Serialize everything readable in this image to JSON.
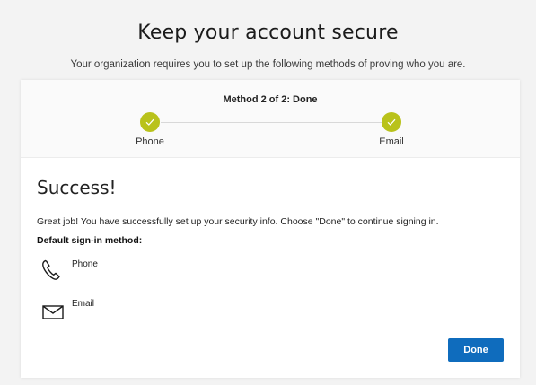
{
  "heading": "Keep your account secure",
  "subheading": "Your organization requires you to set up the following methods of proving who you are.",
  "progress": {
    "title": "Method 2 of 2: Done",
    "steps": [
      {
        "label": "Phone",
        "status": "complete"
      },
      {
        "label": "Email",
        "status": "complete"
      }
    ],
    "step_color": "#b9c21b"
  },
  "success": {
    "title": "Success!",
    "message": "Great job! You have successfully set up your security info. Choose \"Done\" to continue signing in.",
    "default_label": "Default sign-in method:"
  },
  "methods": [
    {
      "name": "Phone",
      "icon": "phone-icon",
      "value": ""
    },
    {
      "name": "Email",
      "icon": "mail-icon",
      "value": ""
    }
  ],
  "done_button": {
    "label": "Done",
    "color": "#0f6cbd"
  }
}
